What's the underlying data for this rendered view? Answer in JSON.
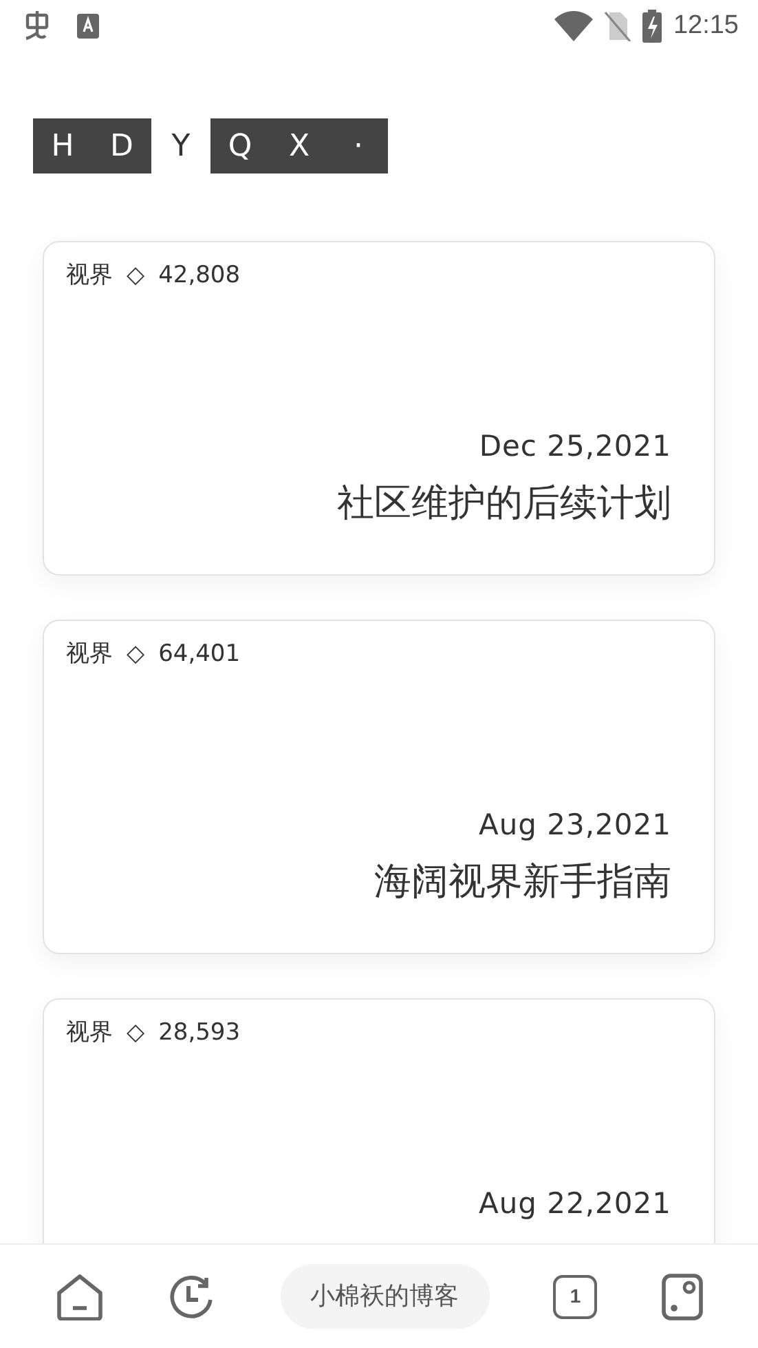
{
  "status_bar": {
    "time": "12:15"
  },
  "logo": [
    {
      "letters": [
        "H",
        "D"
      ],
      "boxed": true
    },
    {
      "letters": [
        "Y"
      ],
      "boxed": false
    },
    {
      "letters": [
        "Q",
        "X",
        "·"
      ],
      "boxed": true
    }
  ],
  "posts": [
    {
      "category": "视界",
      "diamond": "◇",
      "views": "42,808",
      "date": "Dec 25,2021",
      "title": "社区维护的后续计划"
    },
    {
      "category": "视界",
      "diamond": "◇",
      "views": "64,401",
      "date": "Aug 23,2021",
      "title": "海阔视界新手指南"
    },
    {
      "category": "视界",
      "diamond": "◇",
      "views": "28,593",
      "date": "Aug 22,2021"
    }
  ],
  "bottom_bar": {
    "site": "小棉袄的博客",
    "tab_count": "1"
  }
}
